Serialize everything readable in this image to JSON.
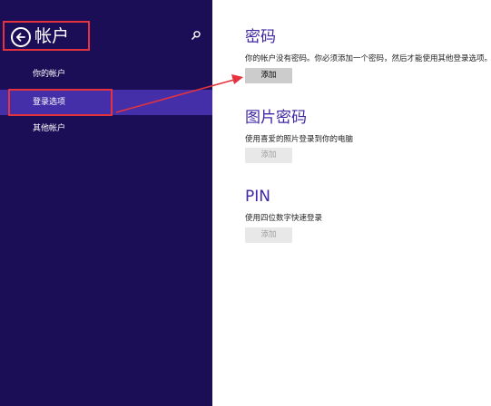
{
  "sidebar": {
    "title": "帐户",
    "items": [
      {
        "label": "你的帐户"
      },
      {
        "label": "登录选项"
      },
      {
        "label": "其他帐户"
      }
    ]
  },
  "main": {
    "password": {
      "title": "密码",
      "description": "你的帐户没有密码。你必须添加一个密码，然后才能使用其他登录选项。",
      "button": "添加"
    },
    "picture_password": {
      "title": "图片密码",
      "description": "使用喜爱的照片登录到你的电脑",
      "button": "添加"
    },
    "pin": {
      "title": "PIN",
      "description": "使用四位数字快速登录",
      "button": "添加"
    }
  },
  "colors": {
    "sidebar_bg": "#1c0e56",
    "selected_item": "#452fa8",
    "section_title": "#4127a4",
    "annotation": "#e5323f"
  },
  "icons": [
    "back-arrow-icon",
    "search-icon"
  ]
}
